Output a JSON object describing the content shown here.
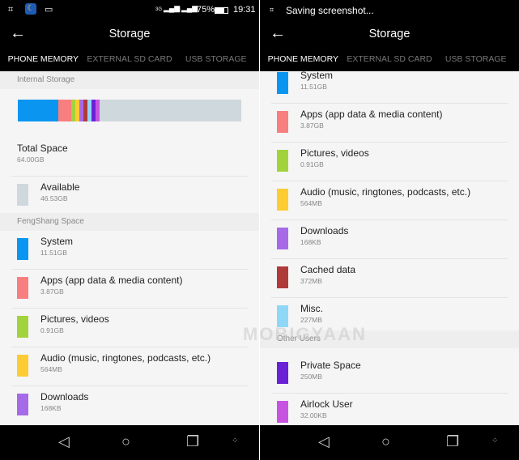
{
  "left": {
    "status": {
      "time": "19:31",
      "battery": "75%",
      "net1": "3G",
      "net2": "G"
    },
    "title": "Storage",
    "tabs": [
      "PHONE MEMORY",
      "EXTERNAL SD CARD",
      "USB STORAGE"
    ],
    "internal_header": "Internal Storage",
    "total": {
      "label": "Total Space",
      "value": "64.00GB"
    },
    "available": {
      "label": "Available",
      "value": "46.53GB",
      "color": "#cfd8dc"
    },
    "fengshang_header": "FengShang Space",
    "items": [
      {
        "label": "System",
        "value": "11.51GB",
        "color": "#0a96f0"
      },
      {
        "label": "Apps (app data & media content)",
        "value": "3.87GB",
        "color": "#f77f7f"
      },
      {
        "label": "Pictures, videos",
        "value": "0.91GB",
        "color": "#a3d33c"
      },
      {
        "label": "Audio (music, ringtones, podcasts, etc.)",
        "value": "564MB",
        "color": "#fdcc33"
      },
      {
        "label": "Downloads",
        "value": "168KB",
        "color": "#a66ae8"
      }
    ],
    "bar_segments_gb": [
      {
        "color": "#0a96f0",
        "gb": 11.51
      },
      {
        "color": "#f77f7f",
        "gb": 3.87
      },
      {
        "color": "#a3d33c",
        "gb": 0.91
      },
      {
        "color": "#fdcc33",
        "gb": 0.564
      },
      {
        "color": "#a66ae8",
        "gb": 0.000168
      },
      {
        "color": "#b03a3a",
        "gb": 0.372
      },
      {
        "color": "#8fd7f7",
        "gb": 0.227
      },
      {
        "color": "#6a22d6",
        "gb": 0.25
      },
      {
        "color": "#c754e0",
        "gb": 3.2e-05
      }
    ]
  },
  "right": {
    "status": {
      "notice": "Saving screenshot..."
    },
    "title": "Storage",
    "tabs": [
      "PHONE MEMORY",
      "EXTERNAL SD CARD",
      "USB STORAGE"
    ],
    "items": [
      {
        "label": "System",
        "value": "11.51GB",
        "color": "#0a96f0"
      },
      {
        "label": "Apps (app data & media content)",
        "value": "3.87GB",
        "color": "#f77f7f"
      },
      {
        "label": "Pictures, videos",
        "value": "0.91GB",
        "color": "#a3d33c"
      },
      {
        "label": "Audio (music, ringtones, podcasts, etc.)",
        "value": "564MB",
        "color": "#fdcc33"
      },
      {
        "label": "Downloads",
        "value": "168KB",
        "color": "#a66ae8"
      },
      {
        "label": "Cached data",
        "value": "372MB",
        "color": "#b03a3a"
      },
      {
        "label": "Misc.",
        "value": "227MB",
        "color": "#8fd7f7"
      }
    ],
    "other_users_header": "Other Users",
    "other_users": [
      {
        "label": "Private Space",
        "value": "250MB",
        "color": "#6a22d6"
      },
      {
        "label": "Airlock User",
        "value": "32.00KB",
        "color": "#c754e0"
      }
    ]
  },
  "watermark": "MOBIGYAAN"
}
